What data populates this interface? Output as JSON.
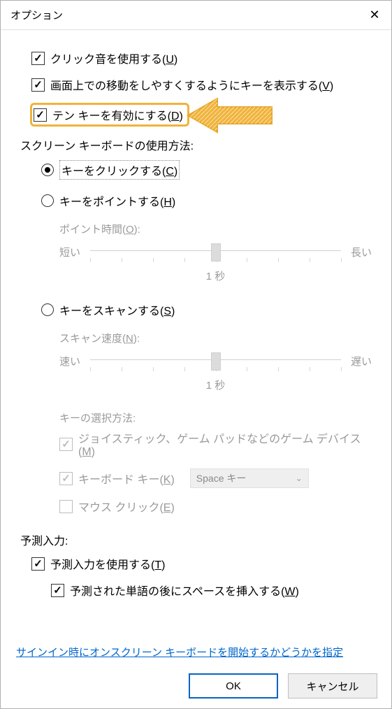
{
  "window": {
    "title": "オプション"
  },
  "checks": {
    "click_sound": {
      "label": "クリック音を使用する(",
      "hot": "U",
      "tail": ")"
    },
    "show_keys": {
      "label": "画面上での移動をしやすくするようにキーを表示する(",
      "hot": "V",
      "tail": ")"
    },
    "numpad": {
      "label": "テン キーを有効にする(",
      "hot": "D",
      "tail": ")"
    }
  },
  "usage_group": "スクリーン キーボードの使用方法:",
  "radios": {
    "click": {
      "label": "キーをクリックする(",
      "hot": "C",
      "tail": ")"
    },
    "hover": {
      "label": "キーをポイントする(",
      "hot": "H",
      "tail": ")"
    },
    "scan": {
      "label": "キーをスキャンする(",
      "hot": "S",
      "tail": ")"
    }
  },
  "hover": {
    "time_label": "ポイント時間(",
    "time_hot": "O",
    "time_tail": "):",
    "left": "短い",
    "right": "長い",
    "mid": "1 秒"
  },
  "scan": {
    "speed_label": "スキャン速度(",
    "speed_hot": "N",
    "speed_tail": "):",
    "left": "速い",
    "right": "遅い",
    "mid": "1 秒",
    "method": "キーの選択方法:",
    "joy": {
      "label": "ジョイスティック、ゲーム パッドなどのゲーム デバイス(",
      "hot": "M",
      "tail": ")"
    },
    "kb": {
      "label": "キーボード キー(",
      "hot": "K",
      "tail": ")"
    },
    "kb_key": "Space キー",
    "mouse": {
      "label": "マウス クリック(",
      "hot": "E",
      "tail": ")"
    }
  },
  "predict_group": "予測入力:",
  "predict": {
    "use": {
      "label": "予測入力を使用する(",
      "hot": "T",
      "tail": ")"
    },
    "space": {
      "label": "予測された単語の後にスペースを挿入する(",
      "hot": "W",
      "tail": ")"
    }
  },
  "link": "サインイン時にオンスクリーン キーボードを開始するかどうかを指定",
  "buttons": {
    "ok": "OK",
    "cancel": "キャンセル"
  }
}
